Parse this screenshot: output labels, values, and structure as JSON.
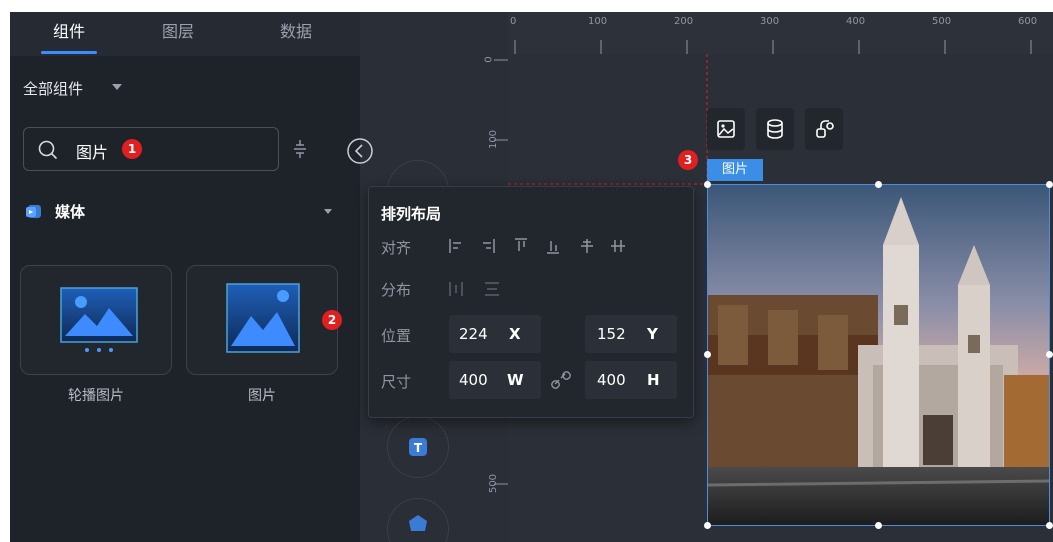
{
  "tabs": [
    {
      "label": "组件",
      "active": true
    },
    {
      "label": "图层",
      "active": false
    },
    {
      "label": "数据",
      "active": false
    }
  ],
  "component_filter": {
    "label": "全部组件"
  },
  "search": {
    "value": "图片",
    "badge": "1"
  },
  "category": {
    "label": "媒体"
  },
  "components": [
    {
      "label": "轮播图片",
      "icon": "carousel-image-icon"
    },
    {
      "label": "图片",
      "icon": "image-icon",
      "badge": "2"
    }
  ],
  "ruler": {
    "top_labels": [
      "0",
      "100",
      "200",
      "300",
      "400",
      "500",
      "600"
    ],
    "left_labels": [
      "0",
      "100",
      "500"
    ]
  },
  "selection": {
    "label": "图片",
    "badge": "3"
  },
  "layout_popup": {
    "title": "排列布局",
    "align_label": "对齐",
    "distribute_label": "分布",
    "position_label": "位置",
    "size_label": "尺寸",
    "position": {
      "x": "224",
      "x_unit": "X",
      "y": "152",
      "y_unit": "Y"
    },
    "size": {
      "w": "400",
      "w_unit": "W",
      "h": "400",
      "h_unit": "H"
    }
  },
  "colors": {
    "accent": "#3d8bff",
    "badge": "#e02020",
    "selection": "#3a8ee6"
  }
}
